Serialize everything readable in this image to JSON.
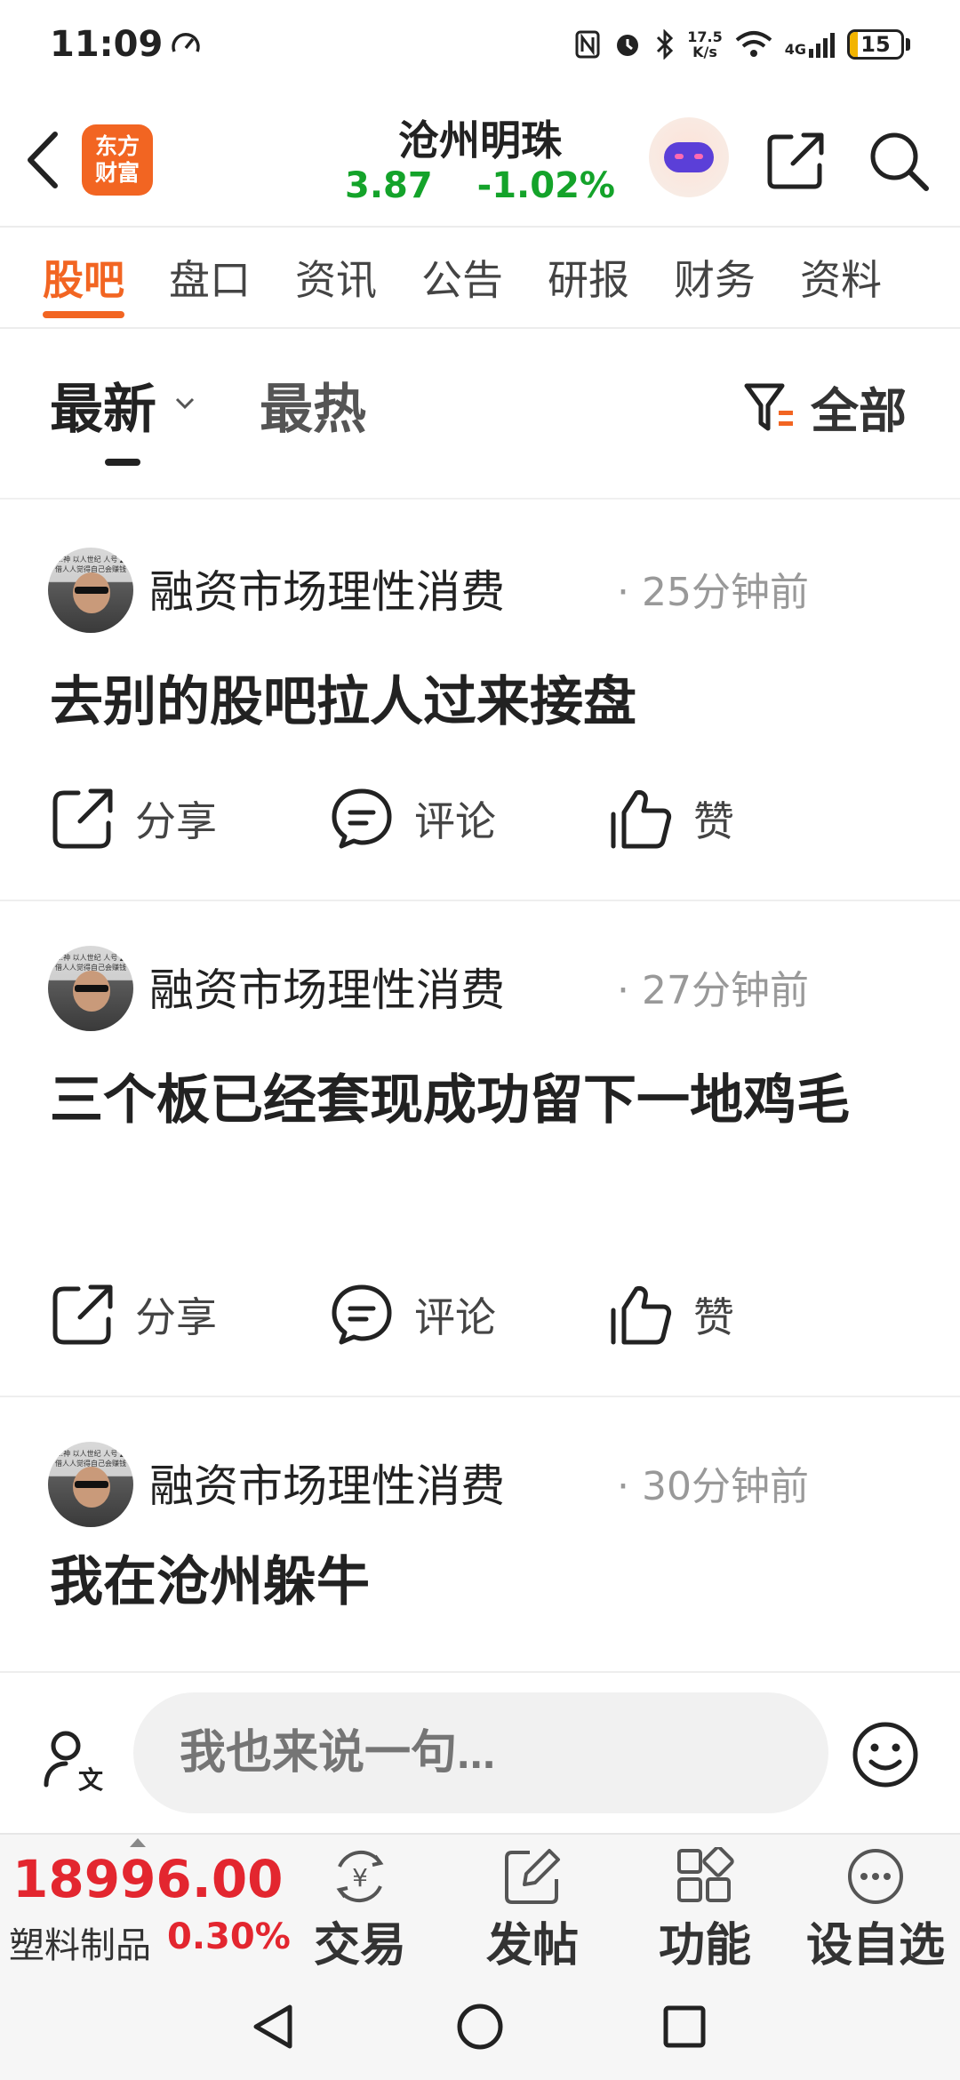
{
  "status_bar": {
    "time": "11:09",
    "net_speed_value": "17.5",
    "net_speed_unit": "K/s",
    "network_type": "4G",
    "battery_level": "15",
    "battery_fraction": 0.15
  },
  "header": {
    "logo_line1": "东方",
    "logo_line2": "财富",
    "stock_name": "沧州明珠",
    "price": "3.87",
    "change_pct": "-1.02%"
  },
  "tabs": [
    {
      "label": "股吧",
      "active": true
    },
    {
      "label": "盘口"
    },
    {
      "label": "资讯"
    },
    {
      "label": "公告"
    },
    {
      "label": "研报"
    },
    {
      "label": "财务"
    },
    {
      "label": "资料"
    }
  ],
  "sort": {
    "latest": "最新",
    "hot": "最热",
    "filter_label": "全部"
  },
  "posts": [
    {
      "author": "融资市场理性消费",
      "time": "· 25分钟前",
      "title": "去别的股吧拉人过来接盘",
      "avatar_caption": "…神 以人世纪 人号 ▲ 借人人觉得自己会赚钱"
    },
    {
      "author": "融资市场理性消费",
      "time": "· 27分钟前",
      "title": "三个板已经套现成功留下一地鸡毛",
      "avatar_caption": "…神 以人世纪 人号 ▲ 借人人觉得自己会赚钱"
    },
    {
      "author": "融资市场理性消费",
      "time": "· 30分钟前",
      "title": "我在沧州躲牛",
      "avatar_caption": "…神 以人世纪 人号 ▲ 借人人觉得自己会赚钱"
    }
  ],
  "actions": {
    "share": "分享",
    "comment": "评论",
    "like": "赞"
  },
  "comment_bar": {
    "placeholder": "我也来说一句..."
  },
  "bottom_bar": {
    "index_value": "18996.00",
    "index_name": "塑料制品",
    "index_change": "0.30%",
    "items": [
      {
        "label": "交易",
        "icon": "yuan-exchange-icon"
      },
      {
        "label": "发帖",
        "icon": "edit-post-icon"
      },
      {
        "label": "功能",
        "icon": "grid-apps-icon"
      },
      {
        "label": "设自选",
        "icon": "more-dots-icon"
      }
    ]
  },
  "colors": {
    "brand_orange": "#f26522",
    "price_down_green": "#14a32a",
    "price_up_red": "#e3262f"
  }
}
